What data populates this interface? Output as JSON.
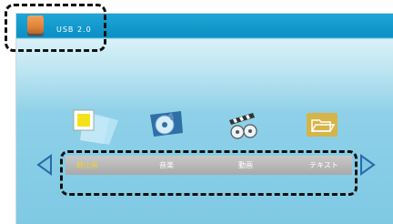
{
  "header": {
    "device_label": "USB 2.0",
    "device_icon": "usb-drive-icon"
  },
  "categories": [
    {
      "label": "静止画",
      "icon": "photo-icon",
      "active": true
    },
    {
      "label": "音楽",
      "icon": "music-icon",
      "active": false
    },
    {
      "label": "動画",
      "icon": "video-icon",
      "active": false
    },
    {
      "label": "テキスト",
      "icon": "folder-icon",
      "active": false
    }
  ],
  "colors": {
    "active_text": "#e8d23a",
    "header_bar": "#0a8fc4",
    "menu_bar": "#b5b5b5"
  }
}
